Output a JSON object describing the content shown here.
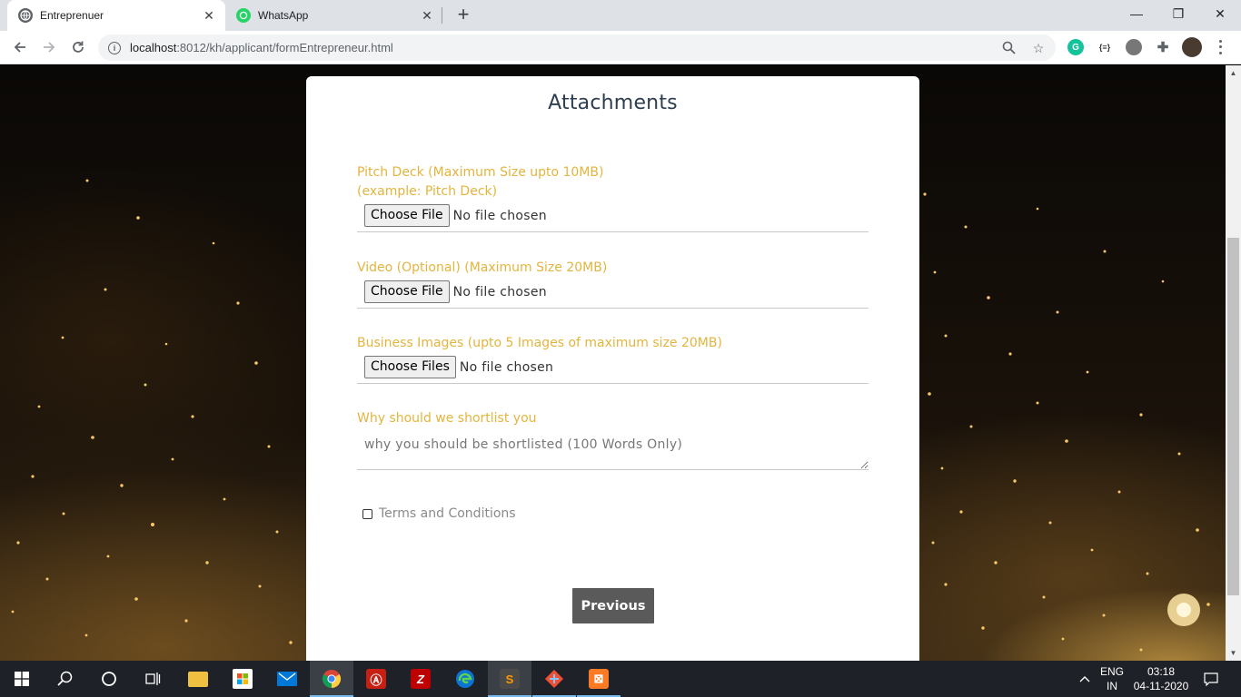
{
  "browser": {
    "tabs": [
      {
        "title": "Entreprenuer",
        "active": true,
        "icon": "globe-icon"
      },
      {
        "title": "WhatsApp",
        "active": false,
        "icon": "whatsapp-icon"
      }
    ],
    "new_tab_label": "+",
    "url_host": "localhost",
    "url_path": ":8012/kh/applicant/formEntrepreneur.html",
    "window_controls": {
      "minimize": "—",
      "restore": "❐",
      "close": "✕"
    }
  },
  "form": {
    "title": "Attachments",
    "pitch_deck": {
      "label_line1": "Pitch Deck (Maximum Size upto 10MB)",
      "label_line2": "(example: Pitch Deck)",
      "button": "Choose File",
      "status": "No file chosen"
    },
    "video": {
      "label": "Video (Optional) (Maximum Size 20MB)",
      "button": "Choose File",
      "status": "No file chosen"
    },
    "business_images": {
      "label": "Business Images (upto 5 Images of maximum size 20MB)",
      "button": "Choose Files",
      "status": "No file chosen"
    },
    "shortlist": {
      "label": "Why should we shortlist you",
      "placeholder": "why you should be shortlisted (100 Words Only)",
      "value": ""
    },
    "terms": {
      "label": "Terms and Conditions",
      "checked": false
    },
    "previous_button": "Previous"
  },
  "taskbar": {
    "apps": [
      "start-icon",
      "search-icon",
      "cortana-icon",
      "task-view-icon",
      "file-explorer-icon",
      "store-icon",
      "mail-icon",
      "chrome-icon",
      "acrobat-icon",
      "filezilla-icon",
      "edge-icon",
      "sublime-icon",
      "git-icon",
      "xampp-icon"
    ],
    "language_top": "ENG",
    "language_bottom": "IN",
    "time": "03:18",
    "date": "04-11-2020"
  },
  "colors": {
    "label_gold": "#e3b53f",
    "title": "#2c3e50",
    "button_dark": "#5a5a5a"
  }
}
